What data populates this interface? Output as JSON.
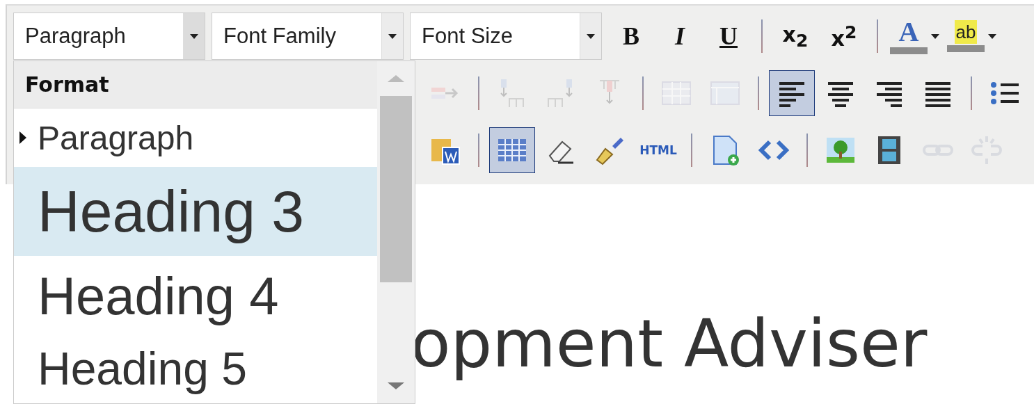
{
  "toolbar": {
    "dropdowns": [
      {
        "value": "Paragraph",
        "open": true
      },
      {
        "value": "Font Family",
        "open": false
      },
      {
        "value": "Font Size",
        "open": false
      }
    ],
    "rows": [
      {
        "items": [
          {
            "kind": "text",
            "label": "B"
          },
          {
            "kind": "text",
            "label": "I"
          },
          {
            "kind": "text",
            "label": "U"
          },
          {
            "kind": "separator"
          },
          {
            "kind": "text",
            "label": "x$_{2}$"
          },
          {
            "kind": "text",
            "label": "x$^{2}$"
          },
          {
            "kind": "separator"
          },
          {
            "kind": "split",
            "label": "A"
          },
          {
            "kind": "split",
            "label": "ab"
          }
        ]
      },
      {
        "items": [
          {
            "kind": "icon",
            "selected": false,
            "disabled": true
          },
          {
            "kind": "separator"
          },
          {
            "kind": "icon",
            "selected": false,
            "disabled": true
          },
          {
            "kind": "icon",
            "selected": false,
            "disabled": true
          },
          {
            "kind": "icon",
            "selected": false,
            "disabled": true
          },
          {
            "kind": "separator"
          },
          {
            "kind": "icon",
            "selected": false,
            "disabled": true
          },
          {
            "kind": "icon",
            "selected": false,
            "disabled": true
          },
          {
            "kind": "separator"
          },
          {
            "kind": "icon",
            "selected": true,
            "disabled": false
          },
          {
            "kind": "icon",
            "selected": false,
            "disabled": false
          },
          {
            "kind": "icon",
            "selected": false,
            "disabled": false
          },
          {
            "kind": "icon",
            "selected": false,
            "disabled": false
          },
          {
            "kind": "separator"
          },
          {
            "kind": "icon",
            "selected": false,
            "disabled": false
          }
        ]
      },
      {
        "items": [
          {
            "kind": "icon",
            "selected": false,
            "disabled": false
          },
          {
            "kind": "separator"
          },
          {
            "kind": "icon",
            "selected": true,
            "disabled": false
          },
          {
            "kind": "icon",
            "selected": false,
            "disabled": false
          },
          {
            "kind": "icon",
            "selected": false,
            "disabled": false
          },
          {
            "kind": "text",
            "label": "HTML"
          },
          {
            "kind": "separator"
          },
          {
            "kind": "icon",
            "selected": false,
            "disabled": false
          },
          {
            "kind": "icon",
            "selected": false,
            "disabled": false
          },
          {
            "kind": "separator"
          },
          {
            "kind": "icon",
            "selected": false,
            "disabled": false
          },
          {
            "kind": "icon",
            "selected": false,
            "disabled": false
          },
          {
            "kind": "icon",
            "selected": false,
            "disabled": true
          },
          {
            "kind": "icon",
            "selected": false,
            "disabled": true
          }
        ]
      }
    ]
  },
  "format_menu": {
    "title": "Format",
    "items": [
      {
        "label": "Paragraph",
        "current": true,
        "highlighted": false
      },
      {
        "label": "Heading 3",
        "current": false,
        "highlighted": true
      },
      {
        "label": "Heading 4",
        "current": false,
        "highlighted": false
      },
      {
        "label": "Heading 5",
        "current": false,
        "highlighted": false
      }
    ]
  },
  "editor": {
    "heading": "opment Adviser"
  }
}
